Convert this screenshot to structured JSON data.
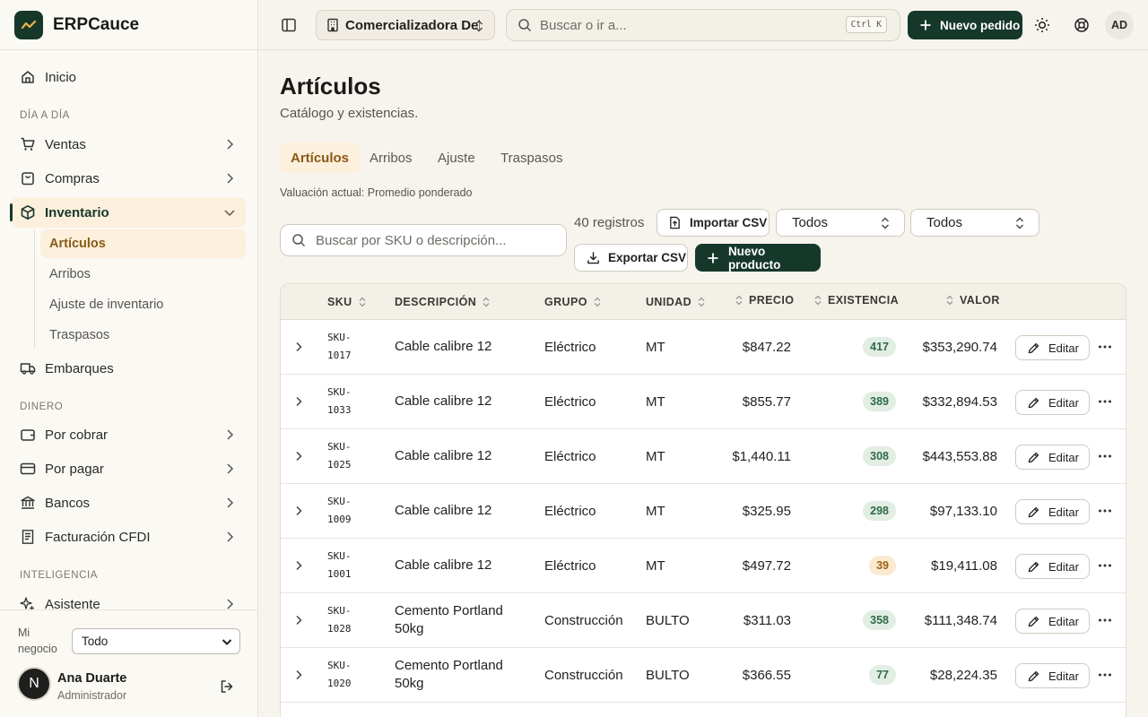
{
  "app": {
    "name": "ERPCauce"
  },
  "sidebar": {
    "home": "Inicio",
    "section_daily": "DÍA A DÍA",
    "ventas": "Ventas",
    "compras": "Compras",
    "inventario": "Inventario",
    "sub_items": [
      "Artículos",
      "Arribos",
      "Ajuste de inventario",
      "Traspasos"
    ],
    "embarques": "Embarques",
    "section_money": "DINERO",
    "por_cobrar": "Por cobrar",
    "por_pagar": "Por pagar",
    "bancos": "Bancos",
    "facturacion": "Facturación CFDI",
    "section_intel": "INTELIGENCIA",
    "asistente": "Asistente"
  },
  "footer": {
    "business_label": "Mi negocio",
    "business_value": "Todo",
    "user_initial": "N",
    "user_name": "Ana Duarte",
    "user_role": "Administrador"
  },
  "topbar": {
    "company": "Comercializadora Del Norte",
    "search_placeholder": "Buscar o ir a...",
    "shortcut": "Ctrl K",
    "new_order": "Nuevo pedido",
    "avatar": "AD"
  },
  "page": {
    "title": "Artículos",
    "subtitle": "Catálogo y existencias.",
    "tabs": [
      "Artículos",
      "Arribos",
      "Ajuste",
      "Traspasos"
    ],
    "valuation": "Valuación actual: Promedio ponderado",
    "search_placeholder": "Buscar por SKU o descripción...",
    "record_count": "40 registros",
    "import_csv": "Importar CSV",
    "filter_1": "Todos",
    "filter_2": "Todos",
    "export_csv": "Exportar CSV",
    "new_product": "Nuevo producto"
  },
  "table": {
    "columns": [
      "SKU",
      "DESCRIPCIÓN",
      "GRUPO",
      "UNIDAD",
      "PRECIO",
      "EXISTENCIA",
      "VALOR"
    ],
    "edit_label": "Editar",
    "rows": [
      {
        "sku": "SKU-\n1017",
        "desc": "Cable calibre 12",
        "group": "Eléctrico",
        "unit": "MT",
        "price": "$847.22",
        "stock": "417",
        "stock_level": "ok",
        "value": "$353,290.74"
      },
      {
        "sku": "SKU-\n1033",
        "desc": "Cable calibre 12",
        "group": "Eléctrico",
        "unit": "MT",
        "price": "$855.77",
        "stock": "389",
        "stock_level": "ok",
        "value": "$332,894.53"
      },
      {
        "sku": "SKU-\n1025",
        "desc": "Cable calibre 12",
        "group": "Eléctrico",
        "unit": "MT",
        "price": "$1,440.11",
        "stock": "308",
        "stock_level": "ok",
        "value": "$443,553.88"
      },
      {
        "sku": "SKU-\n1009",
        "desc": "Cable calibre 12",
        "group": "Eléctrico",
        "unit": "MT",
        "price": "$325.95",
        "stock": "298",
        "stock_level": "ok",
        "value": "$97,133.10"
      },
      {
        "sku": "SKU-\n1001",
        "desc": "Cable calibre 12",
        "group": "Eléctrico",
        "unit": "MT",
        "price": "$497.72",
        "stock": "39",
        "stock_level": "low",
        "value": "$19,411.08"
      },
      {
        "sku": "SKU-\n1028",
        "desc": "Cemento Portland\n50kg",
        "group": "Construcción",
        "unit": "BULTO",
        "price": "$311.03",
        "stock": "358",
        "stock_level": "ok",
        "value": "$111,348.74"
      },
      {
        "sku": "SKU-\n1020",
        "desc": "Cemento Portland\n50kg",
        "group": "Construcción",
        "unit": "BULTO",
        "price": "$366.55",
        "stock": "77",
        "stock_level": "ok",
        "value": "$28,224.35"
      }
    ]
  },
  "colors": {
    "brand": "#16382b",
    "accent": "#fcefdc",
    "accent_text": "#8a5a17"
  }
}
